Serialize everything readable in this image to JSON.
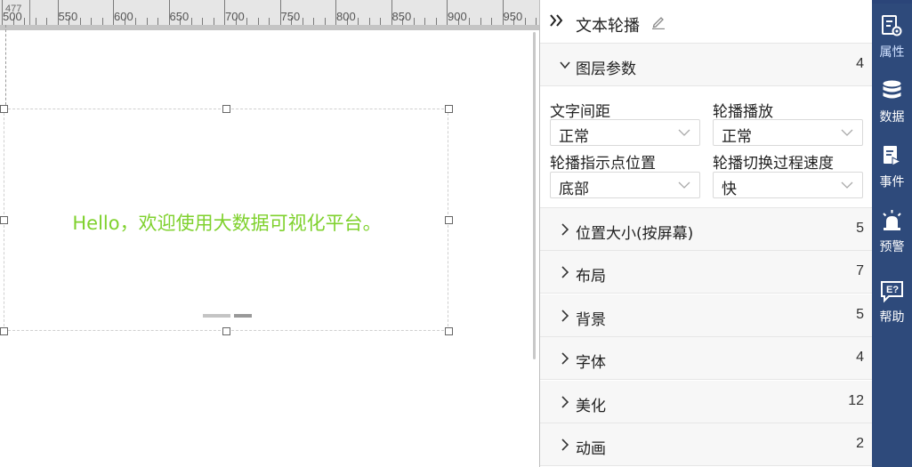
{
  "ruler": {
    "cursor_position": "477",
    "labels": [
      "500",
      "550",
      "600",
      "650",
      "700",
      "750",
      "800",
      "850",
      "900",
      "950"
    ]
  },
  "canvas": {
    "component_text": "Hello，欢迎使用大数据可视化平台。",
    "text_color": "#7fd12d",
    "indicator_colors": [
      "#c4c4c4",
      "#999999"
    ]
  },
  "panel": {
    "title": "文本轮播",
    "layer_section": {
      "title": "图层参数",
      "count": "4"
    },
    "fields": [
      {
        "label": "文字间距",
        "value": "正常"
      },
      {
        "label": "轮播播放",
        "value": "正常"
      },
      {
        "label": "轮播指示点位置",
        "value": "底部"
      },
      {
        "label": "轮播切换过程速度",
        "value": "快"
      }
    ],
    "sections": [
      {
        "title": "位置大小(按屏幕)",
        "count": "5"
      },
      {
        "title": "布局",
        "count": "7"
      },
      {
        "title": "背景",
        "count": "5"
      },
      {
        "title": "字体",
        "count": "4"
      },
      {
        "title": "美化",
        "count": "12"
      },
      {
        "title": "动画",
        "count": "2"
      }
    ]
  },
  "sidebar": {
    "accent_color": "#2e4a7b",
    "items": [
      {
        "label": "属性",
        "icon": "properties-icon"
      },
      {
        "label": "数据",
        "icon": "database-icon"
      },
      {
        "label": "事件",
        "icon": "event-icon"
      },
      {
        "label": "预警",
        "icon": "alarm-icon"
      },
      {
        "label": "帮助",
        "icon": "help-icon"
      }
    ]
  }
}
